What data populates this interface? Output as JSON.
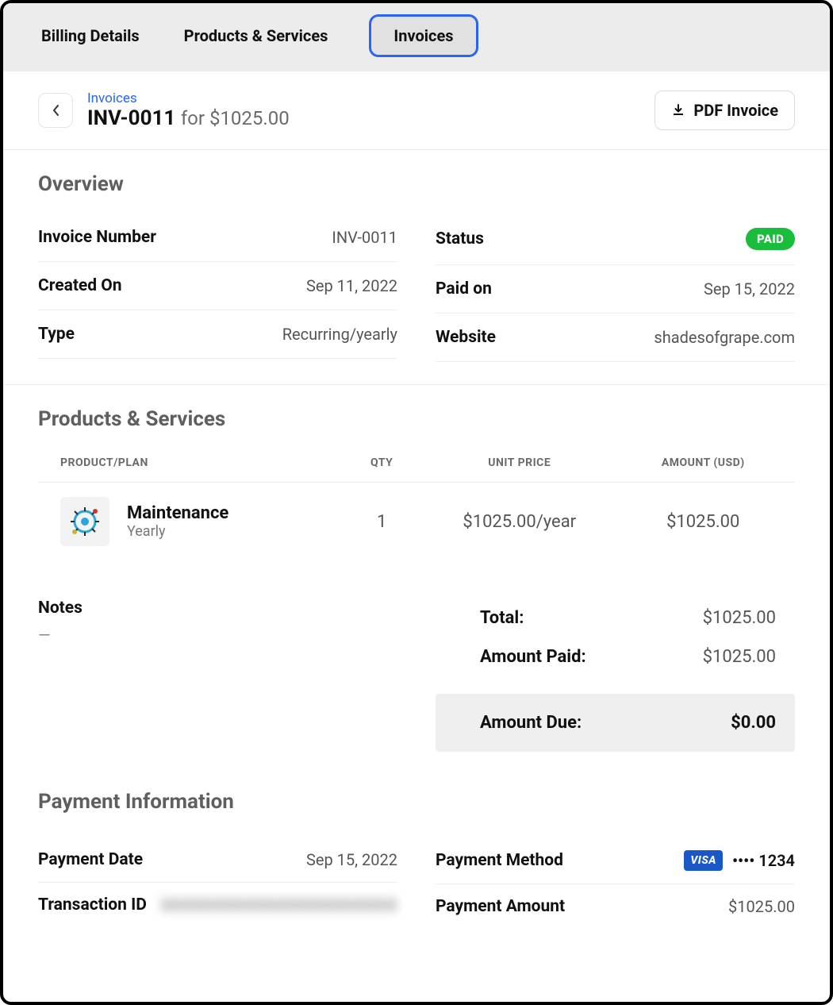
{
  "tabs": {
    "billing": "Billing Details",
    "products": "Products & Services",
    "invoices": "Invoices"
  },
  "header": {
    "breadcrumb": "Invoices",
    "invoice_id": "INV-0011",
    "for_word": "for",
    "amount": "$1025.00",
    "pdf_label": "PDF Invoice"
  },
  "overview": {
    "title": "Overview",
    "rows": {
      "invoice_number": {
        "label": "Invoice Number",
        "value": "INV-0011"
      },
      "created_on": {
        "label": "Created On",
        "value": "Sep 11, 2022"
      },
      "type": {
        "label": "Type",
        "value": "Recurring/yearly"
      },
      "status": {
        "label": "Status",
        "value": "PAID"
      },
      "paid_on": {
        "label": "Paid on",
        "value": "Sep 15, 2022"
      },
      "website": {
        "label": "Website",
        "value": "shadesofgrape.com"
      }
    }
  },
  "products_section": {
    "title": "Products & Services",
    "head": {
      "c1": "PRODUCT/PLAN",
      "c2": "QTY",
      "c3": "UNIT PRICE",
      "c4": "AMOUNT (USD)"
    },
    "items": [
      {
        "name": "Maintenance",
        "period": "Yearly",
        "qty": "1",
        "unit_price": "$1025.00/year",
        "amount": "$1025.00"
      }
    ]
  },
  "notes": {
    "label": "Notes",
    "value": "—"
  },
  "totals": {
    "total": {
      "label": "Total:",
      "value": "$1025.00"
    },
    "amount_paid": {
      "label": "Amount Paid:",
      "value": "$1025.00"
    },
    "amount_due": {
      "label": "Amount Due:",
      "value": "$0.00"
    }
  },
  "payment": {
    "title": "Payment Information",
    "rows": {
      "payment_date": {
        "label": "Payment Date",
        "value": "Sep 15, 2022"
      },
      "transaction_id": {
        "label": "Transaction ID",
        "value": "XXXXXXXXXXXXXXXXXXXXXX"
      },
      "payment_method": {
        "label": "Payment Method",
        "brand": "VISA",
        "mask": "•••• 1234"
      },
      "payment_amount": {
        "label": "Payment Amount",
        "value": "$1025.00"
      }
    }
  }
}
